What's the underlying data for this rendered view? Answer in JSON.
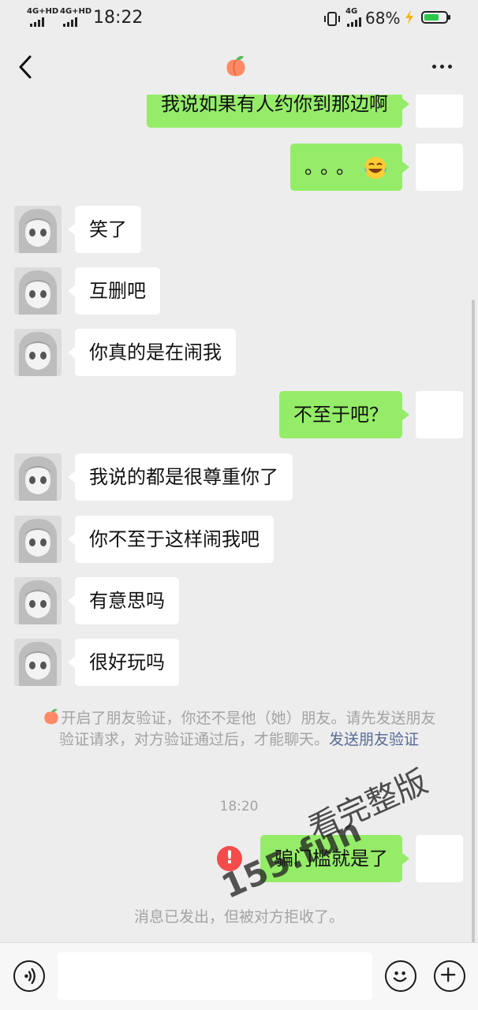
{
  "status_bar": {
    "network1": "4G+HD",
    "network2": "4G+HD",
    "time": "18:22",
    "network3": "4G",
    "battery_percent": "68%",
    "battery_level": 0.68,
    "battery_color": "#2bc84d"
  },
  "header": {
    "title_icon": "peach-emoji-icon",
    "back_icon": "chevron-left-icon",
    "more_icon": "more-dots-icon"
  },
  "messages": [
    {
      "sender": "me",
      "text": "我说如果有人约你到那边啊"
    },
    {
      "sender": "me",
      "text": "。。。",
      "emoji": "rofl-emoji-icon"
    },
    {
      "sender": "other",
      "text": "笑了"
    },
    {
      "sender": "other",
      "text": "互删吧"
    },
    {
      "sender": "other",
      "text": "你真的是在闹我"
    },
    {
      "sender": "me",
      "text": "不至于吧？"
    },
    {
      "sender": "other",
      "text": "我说的都是很尊重你了"
    },
    {
      "sender": "other",
      "text": "你不至于这样闹我吧"
    },
    {
      "sender": "other",
      "text": "有意思吗"
    },
    {
      "sender": "other",
      "text": "很好玩吗"
    }
  ],
  "system_notice": {
    "text": "开启了朋友验证，你还不是他（她）朋友。请先发送朋友验证请求，对方验证通过后，才能聊天。",
    "link": "发送朋友验证"
  },
  "timestamp": "18:20",
  "last_message": {
    "sender": "me",
    "text": "骗门槛就是了",
    "status_icon": "error-icon"
  },
  "rejected_notice": "消息已发出，但被对方拒收了。",
  "watermark": {
    "site": "155.fun",
    "text": "看完整版"
  },
  "input_bar": {
    "voice_icon": "voice-icon",
    "emoji_icon": "emoji-icon",
    "plus_icon": "plus-icon"
  },
  "colors": {
    "my_bubble": "#95ec69",
    "their_bubble": "#ffffff",
    "background": "#ededed",
    "link": "#576b95",
    "error": "#f54b4b"
  }
}
